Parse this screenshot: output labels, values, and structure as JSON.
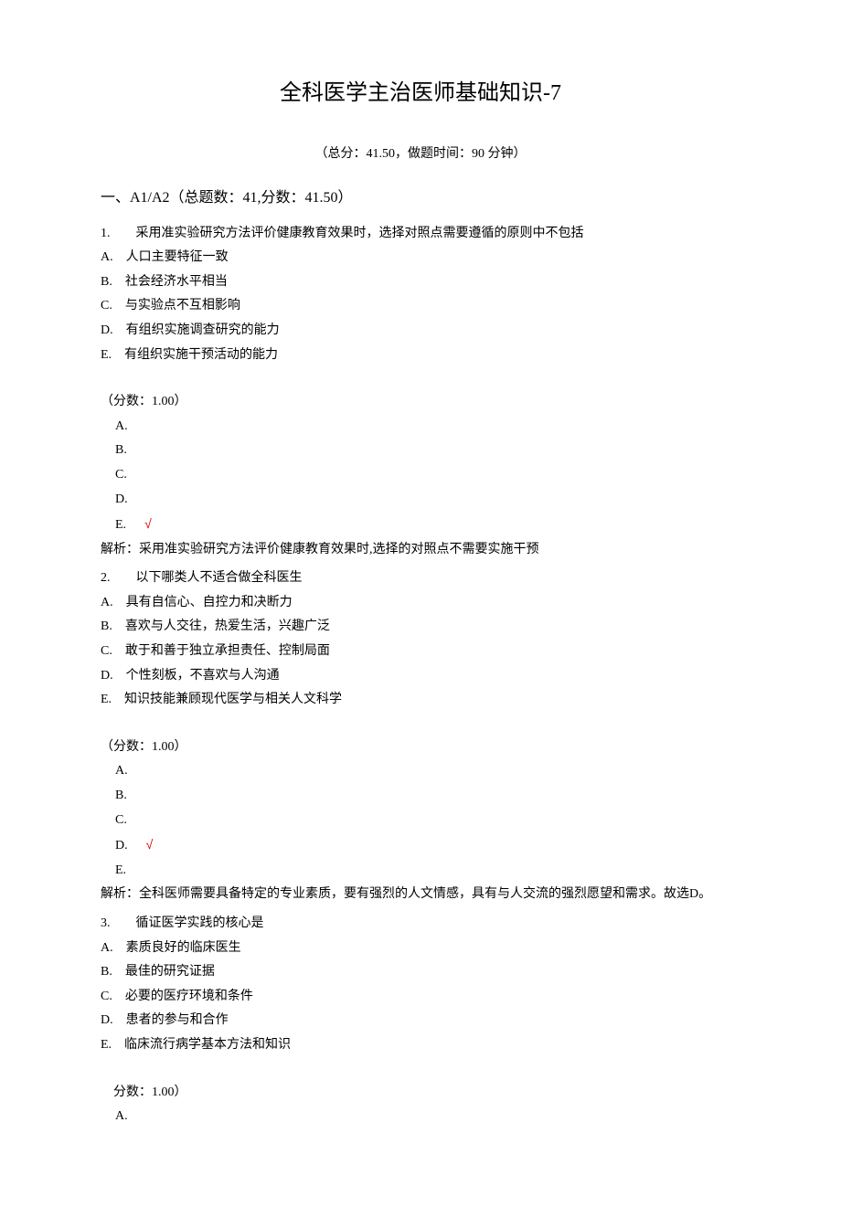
{
  "title": "全科医学主治医师基础知识-7",
  "meta": "（总分：41.50，做题时间：90 分钟）",
  "section": "一、A1/A2（总题数：41,分数：41.50）",
  "questions": [
    {
      "num": "1.　　",
      "text": "采用准实验研究方法评价健康教育效果时，选择对照点需要遵循的原则中不包括",
      "opts": [
        "A.　人口主要特征一致",
        "B.　社会经济水平相当",
        "C.　与实验点不互相影响",
        "D.　有组织实施调查研究的能力",
        "E.　有组织实施干预活动的能力"
      ],
      "score": "（分数：1.00）",
      "answers": [
        "A.",
        "B.",
        "C.",
        "D.",
        "E."
      ],
      "correct": 4,
      "mark": "√",
      "explain": "解析：采用准实验研究方法评价健康教育效果时,选择的对照点不需要实施干预"
    },
    {
      "num": "2.　　",
      "text": "以下哪类人不适合做全科医生",
      "opts": [
        "A.　具有自信心、自控力和决断力",
        "B.　喜欢与人交往，热爱生活，兴趣广泛",
        "C.　敢于和善于独立承担责任、控制局面",
        "D.　个性刻板，不喜欢与人沟通",
        "E.　知识技能兼顾现代医学与相关人文科学"
      ],
      "score": "（分数：1.00）",
      "answers": [
        "A.",
        "B.",
        "C.",
        "D.",
        "E."
      ],
      "correct": 3,
      "mark": "√",
      "explain": "解析：全科医师需要具备特定的专业素质，要有强烈的人文情感，具有与人交流的强烈愿望和需求。故选D。"
    },
    {
      "num": "3.　　",
      "text": "循证医学实践的核心是",
      "opts": [
        "A.　素质良好的临床医生",
        "B.　最佳的研究证据",
        "C.　必要的医疗环境和条件",
        "D.　患者的参与和合作",
        "E.　临床流行病学基本方法和知识"
      ],
      "score": "　分数：1.00）",
      "answers": [
        "A."
      ],
      "correct": -1,
      "mark": "",
      "explain": ""
    }
  ]
}
